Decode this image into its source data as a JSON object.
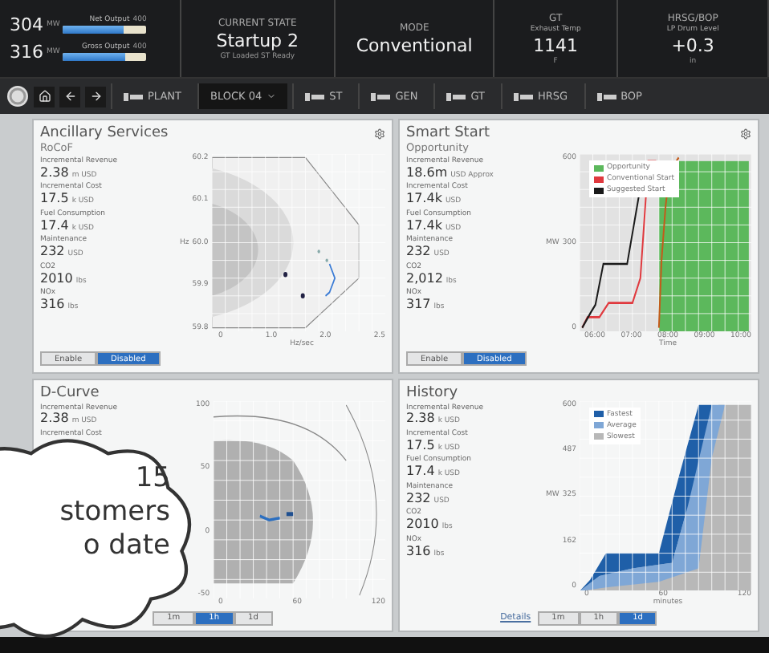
{
  "header": {
    "outputs": [
      {
        "value": "304",
        "unit": "MW",
        "label": "Net Output",
        "max": "400",
        "level": 0.72
      },
      {
        "value": "316",
        "unit": "MW",
        "label": "Gross Output",
        "max": "400",
        "level": 0.74
      }
    ],
    "stats": [
      {
        "title": "CURRENT STATE",
        "value": "Startup 2",
        "note": "GT Loaded ST Ready"
      },
      {
        "title": "MODE",
        "value": "Conventional"
      },
      {
        "title": "GT",
        "caption": "Exhaust Temp",
        "value": "1141",
        "note": "F"
      },
      {
        "title": "HRSG/BOP",
        "caption": "LP Drum Level",
        "value": "+0.3",
        "note": "in"
      }
    ]
  },
  "nav": {
    "items": [
      {
        "label": "PLANT",
        "kind": "plain",
        "selected": false
      },
      {
        "label": "BLOCK 04",
        "kind": "dropdown",
        "selected": true
      },
      {
        "label": "ST",
        "kind": "plain",
        "selected": false
      },
      {
        "label": "GEN",
        "kind": "plain",
        "selected": false
      },
      {
        "label": "GT",
        "kind": "plain",
        "selected": false
      },
      {
        "label": "HRSG",
        "kind": "plain",
        "selected": false
      },
      {
        "label": "BOP",
        "kind": "plain",
        "selected": false
      }
    ]
  },
  "panels": [
    {
      "title": "Ancillary Services",
      "subtitle": "RoCoF",
      "settings": true,
      "metrics": [
        {
          "label": "Incremental Revenue",
          "value": "2.38",
          "unit": "m USD"
        },
        {
          "label": "Incremental Cost",
          "value": "17.5",
          "unit": "k USD"
        },
        {
          "label": "Fuel Consumption",
          "value": "17.4",
          "unit": "k USD"
        },
        {
          "label": "Maintenance",
          "value": "232",
          "unit": "USD"
        },
        {
          "label": "CO2",
          "value": "2010",
          "unit": "lbs"
        },
        {
          "label": "NOx",
          "value": "316",
          "unit": "lbs"
        }
      ],
      "chart": {
        "kind": "fan",
        "ylabel": "Hz",
        "yticks": [
          "60.2",
          "60.1",
          "60.0",
          "59.9",
          "59.8"
        ],
        "xticks": [
          "0",
          "1.0",
          "2.0",
          "2.5"
        ],
        "xlabel": "Hz/sec"
      },
      "toggles": [
        {
          "label": "Enable",
          "selected": false
        },
        {
          "label": "Disabled",
          "selected": true
        }
      ]
    },
    {
      "title": "Smart Start",
      "subtitle": "Opportunity",
      "settings": true,
      "metrics": [
        {
          "label": "Incremental Revenue",
          "value": "18.6m",
          "unit": "USD Approx"
        },
        {
          "label": "Incremental Cost",
          "value": "17.4k",
          "unit": "USD"
        },
        {
          "label": "Fuel Consumption",
          "value": "17.4k",
          "unit": "USD"
        },
        {
          "label": "Maintenance",
          "value": "232",
          "unit": "USD"
        },
        {
          "label": "CO2",
          "value": "2,012",
          "unit": "lbs"
        },
        {
          "label": "NOx",
          "value": "317",
          "unit": "lbs"
        }
      ],
      "chart": {
        "kind": "start",
        "ylabel": "MW",
        "yticks": [
          "600",
          "300",
          "0"
        ],
        "xticks": [
          "06:00",
          "07:00",
          "08:00",
          "09:00",
          "10:00"
        ],
        "xlabel": "Time",
        "legend": [
          {
            "label": "Opportunity",
            "color": "#5cb85c"
          },
          {
            "label": "Conventional Start",
            "color": "#e0393e"
          },
          {
            "label": "Suggested Start",
            "color": "#1a1a1a"
          }
        ]
      },
      "toggles": [
        {
          "label": "Enable",
          "selected": false
        },
        {
          "label": "Disabled",
          "selected": true
        }
      ]
    },
    {
      "title": "D-Curve",
      "settings": false,
      "metrics": [
        {
          "label": "Incremental Revenue",
          "value": "2.38",
          "unit": "m USD"
        },
        {
          "label": "Incremental Cost"
        }
      ],
      "chart": {
        "kind": "capability",
        "yticks": [
          "100",
          "50",
          "0",
          "-50"
        ],
        "xticks": [
          "0",
          "60",
          "120"
        ]
      },
      "toggles": [
        {
          "label": "1m",
          "selected": false
        },
        {
          "label": "1h",
          "selected": true
        },
        {
          "label": "1d",
          "selected": false
        }
      ]
    },
    {
      "title": "History",
      "settings": false,
      "metrics": [
        {
          "label": "Incremental Revenue",
          "value": "2.38",
          "unit": "k USD"
        },
        {
          "label": "Incremental Cost",
          "value": "17.5",
          "unit": "k USD"
        },
        {
          "label": "Fuel Consumption",
          "value": "17.4",
          "unit": "k USD"
        },
        {
          "label": "Maintenance",
          "value": "232",
          "unit": "USD"
        },
        {
          "label": "CO2",
          "value": "2010",
          "unit": "lbs"
        },
        {
          "label": "NOx",
          "value": "316",
          "unit": "lbs"
        }
      ],
      "chart": {
        "kind": "history",
        "ylabel": "MW",
        "yticks": [
          "600",
          "487",
          "325",
          "162",
          "0"
        ],
        "xticks": [
          "0",
          "60",
          "120"
        ],
        "xlabel": "minutes",
        "legend": [
          {
            "label": "Fastest",
            "color": "#1f5fa8"
          },
          {
            "label": "Average",
            "color": "#7fa7d6"
          },
          {
            "label": "Slowest",
            "color": "#b8b8b8"
          }
        ]
      },
      "toggles": [
        {
          "label": "1m",
          "selected": false
        },
        {
          "label": "1h",
          "selected": false
        },
        {
          "label": "1d",
          "selected": true
        }
      ],
      "link": "Details"
    }
  ],
  "callout": {
    "lines": [
      "15",
      "stomers",
      "o date"
    ]
  }
}
